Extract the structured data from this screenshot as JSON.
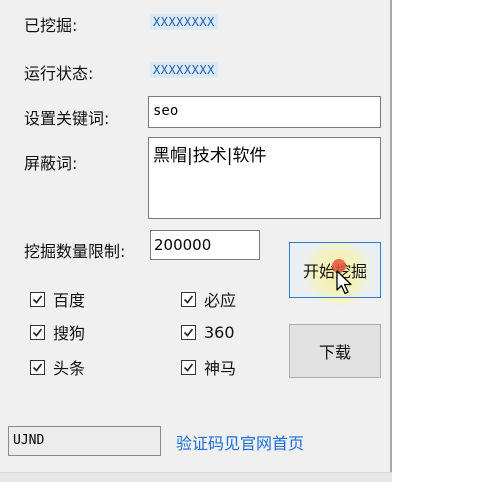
{
  "stats": {
    "mined_label": "已挖掘:",
    "mined_value": "XXXXXXXX",
    "status_label": "运行状态:",
    "status_value": "XXXXXXXX"
  },
  "keyword": {
    "label": "设置关键词:",
    "value": "seo"
  },
  "block": {
    "label": "屏蔽词:",
    "value": "黑帽|技术|软件"
  },
  "limit": {
    "label": "挖掘数量限制:",
    "value": "200000"
  },
  "engines": [
    {
      "label": "百度",
      "checked": true
    },
    {
      "label": "必应",
      "checked": true
    },
    {
      "label": "搜狗",
      "checked": true
    },
    {
      "label": "360",
      "checked": true
    },
    {
      "label": "头条",
      "checked": true
    },
    {
      "label": "神马",
      "checked": true
    }
  ],
  "buttons": {
    "start": "开始挖掘",
    "download": "下载"
  },
  "captcha": {
    "value": "UJND",
    "link": "验证码见官网首页"
  },
  "colors": {
    "window_bg": "#f0f0f0",
    "accent_highlight": "#fff59a",
    "link": "#1a6fd6",
    "stat_value": "#1a5fb4"
  }
}
